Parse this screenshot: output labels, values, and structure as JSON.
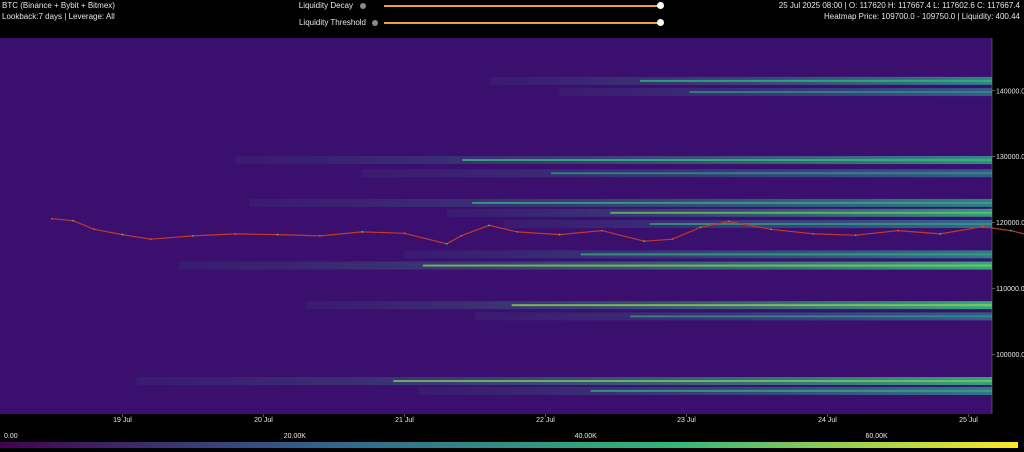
{
  "header": {
    "title": "BTC (Binance + Bybit + Bitmex)",
    "subtitle": "Lookback:7 days | Leverage: All",
    "ohlc": "25 Jul 2025 08:00 | O: 117620 H: 117667.4 L: 117602.6 C: 117667.4",
    "heatmap_info": "Heatmap Price: 109700.0 - 109750.0 | Liquidity: 400.44"
  },
  "controls": {
    "decay_label": "Liquidity Decay",
    "decay_value": 1.0,
    "threshold_label": "Liquidity Threshold",
    "threshold_value": 1.0,
    "accent_color": "#e8a33b",
    "info_icon": "info-dot-icon"
  },
  "chart_data": {
    "type": "heatmap",
    "title": "",
    "xlabel": "",
    "ylabel": "",
    "x_ticks": [
      "19 Jul",
      "20 Jul",
      "21 Jul",
      "22 Jul",
      "23 Jul",
      "24 Jul",
      "25 Jul"
    ],
    "y_ticks": [
      100000,
      110000,
      120000,
      130000,
      140000
    ],
    "y_tick_labels": [
      "100000.0",
      "110000.0",
      "120000.0",
      "130000.0",
      "140000.0"
    ],
    "ylim": [
      91000,
      148000
    ],
    "xlim_days": [
      0,
      7.1
    ],
    "background_color": "#3b0f6e",
    "colorscale": [
      "#440154",
      "#31688e",
      "#35b779",
      "#fde725"
    ],
    "colorbar_range": [
      0,
      70000
    ],
    "colorbar_ticks": [
      {
        "value": 0,
        "label": "0.00"
      },
      {
        "value": 20000,
        "label": "20.00K"
      },
      {
        "value": 40000,
        "label": "40.00K"
      },
      {
        "value": 60000,
        "label": "60.00K"
      }
    ],
    "liquidity_bands": [
      {
        "price": 141500,
        "start_day": 3.1,
        "intensity": 0.45
      },
      {
        "price": 139800,
        "start_day": 3.6,
        "intensity": 0.3
      },
      {
        "price": 129500,
        "start_day": 1.3,
        "intensity": 0.48
      },
      {
        "price": 127500,
        "start_day": 2.2,
        "intensity": 0.3
      },
      {
        "price": 123000,
        "start_day": 1.4,
        "intensity": 0.42
      },
      {
        "price": 121500,
        "start_day": 2.8,
        "intensity": 0.55
      },
      {
        "price": 119800,
        "start_day": 3.2,
        "intensity": 0.35
      },
      {
        "price": 115200,
        "start_day": 2.5,
        "intensity": 0.4
      },
      {
        "price": 113500,
        "start_day": 0.9,
        "intensity": 0.6
      },
      {
        "price": 107500,
        "start_day": 1.8,
        "intensity": 0.62
      },
      {
        "price": 105800,
        "start_day": 3.0,
        "intensity": 0.3
      },
      {
        "price": 96000,
        "start_day": 0.6,
        "intensity": 0.58
      },
      {
        "price": 94500,
        "start_day": 2.6,
        "intensity": 0.4
      }
    ],
    "price_series": {
      "name": "",
      "x_days": [
        0,
        0.15,
        0.3,
        0.5,
        0.7,
        1.0,
        1.3,
        1.6,
        1.9,
        2.2,
        2.5,
        2.8,
        2.9,
        3.1,
        3.3,
        3.6,
        3.9,
        4.2,
        4.4,
        4.6,
        4.8,
        5.1,
        5.4,
        5.7,
        6.0,
        6.3,
        6.6,
        6.8,
        6.95,
        7.05
      ],
      "y": [
        120600,
        120300,
        119000,
        118200,
        117500,
        118000,
        118300,
        118200,
        118000,
        118600,
        118400,
        116800,
        118000,
        119600,
        118600,
        118200,
        118800,
        117200,
        117500,
        119300,
        120200,
        119000,
        118300,
        118100,
        118800,
        118300,
        119400,
        118800,
        118000,
        116200
      ]
    }
  }
}
